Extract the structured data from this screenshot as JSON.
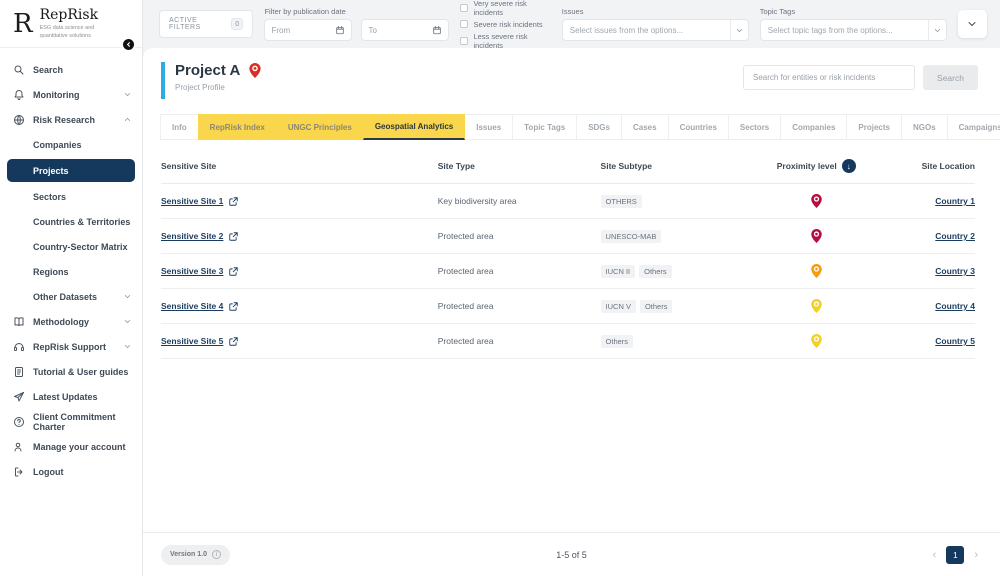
{
  "sidebar": {
    "logo": {
      "brand": "RepRisk",
      "tagline": "ESG data science and quantitative solutions"
    },
    "items": [
      {
        "label": "Search"
      },
      {
        "label": "Monitoring"
      },
      {
        "label": "Risk Research"
      },
      {
        "label": "Companies"
      },
      {
        "label": "Projects"
      },
      {
        "label": "Sectors"
      },
      {
        "label": "Countries & Territories"
      },
      {
        "label": "Country-Sector Matrix"
      },
      {
        "label": "Regions"
      },
      {
        "label": "Other Datasets"
      },
      {
        "label": "Methodology"
      },
      {
        "label": "RepRisk Support"
      },
      {
        "label": "Tutorial & User guides"
      },
      {
        "label": "Latest Updates"
      },
      {
        "label": "Client Commitment Charter"
      },
      {
        "label": "Manage your account"
      },
      {
        "label": "Logout"
      }
    ]
  },
  "topbar": {
    "active_filters_label": "ACTIVE FILTERS",
    "active_filters_count": "0",
    "date_filter_label": "Filter by publication date",
    "from_placeholder": "From",
    "to_placeholder": "To",
    "severity_options": [
      "Very severe risk incidents",
      "Severe risk incidents",
      "Less severe risk incidents"
    ],
    "issues_label": "Issues",
    "issues_placeholder": "Select issues from the options...",
    "topic_tags_label": "Topic Tags",
    "topic_tags_placeholder": "Select topic tags from the options..."
  },
  "main": {
    "title": "Project A",
    "subtitle": "Project Profile",
    "search_placeholder": "Search for entities or risk incidents",
    "search_button": "Search",
    "tabs": [
      {
        "label": "Info",
        "state": "default"
      },
      {
        "label": "RepRisk Index",
        "state": "highlighted"
      },
      {
        "label": "UNGC Principles",
        "state": "highlighted"
      },
      {
        "label": "Geospatial Analytics",
        "state": "active"
      },
      {
        "label": "Issues",
        "state": "default"
      },
      {
        "label": "Topic Tags",
        "state": "default"
      },
      {
        "label": "SDGs",
        "state": "default"
      },
      {
        "label": "Cases",
        "state": "default"
      },
      {
        "label": "Countries",
        "state": "default"
      },
      {
        "label": "Sectors",
        "state": "default"
      },
      {
        "label": "Companies",
        "state": "default"
      },
      {
        "label": "Projects",
        "state": "default"
      },
      {
        "label": "NGOs",
        "state": "default"
      },
      {
        "label": "Campaigns",
        "state": "default"
      }
    ],
    "table": {
      "columns": [
        "Sensitive Site",
        "Site Type",
        "Site Subtype",
        "Proximity level",
        "Site Location"
      ],
      "rows": [
        {
          "site": "Sensitive Site 1",
          "type": "Key biodiversity area",
          "subtypes": [
            "OTHERS"
          ],
          "proximity_color": "#B60E41",
          "country": "Country 1"
        },
        {
          "site": "Sensitive Site 2",
          "type": "Protected area",
          "subtypes": [
            "UNESCO-MAB"
          ],
          "proximity_color": "#B60E41",
          "country": "Country 2"
        },
        {
          "site": "Sensitive Site 3",
          "type": "Protected area",
          "subtypes": [
            "IUCN II",
            "Others"
          ],
          "proximity_color": "#F59C0C",
          "country": "Country 3"
        },
        {
          "site": "Sensitive Site 4",
          "type": "Protected area",
          "subtypes": [
            "IUCN V",
            "Others"
          ],
          "proximity_color": "#F3D026",
          "country": "Country 4"
        },
        {
          "site": "Sensitive Site 5",
          "type": "Protected area",
          "subtypes": [
            "Others"
          ],
          "proximity_color": "#F3D026",
          "country": "Country 5"
        }
      ]
    },
    "footer": {
      "version": "Version 1.0",
      "range": "1-5 of 5",
      "page": "1"
    }
  },
  "colors": {
    "navy": "#14395D",
    "tab_yellow": "#F9D64B",
    "accent_cyan": "#2BACE2",
    "title_pin_red": "#D93025"
  }
}
